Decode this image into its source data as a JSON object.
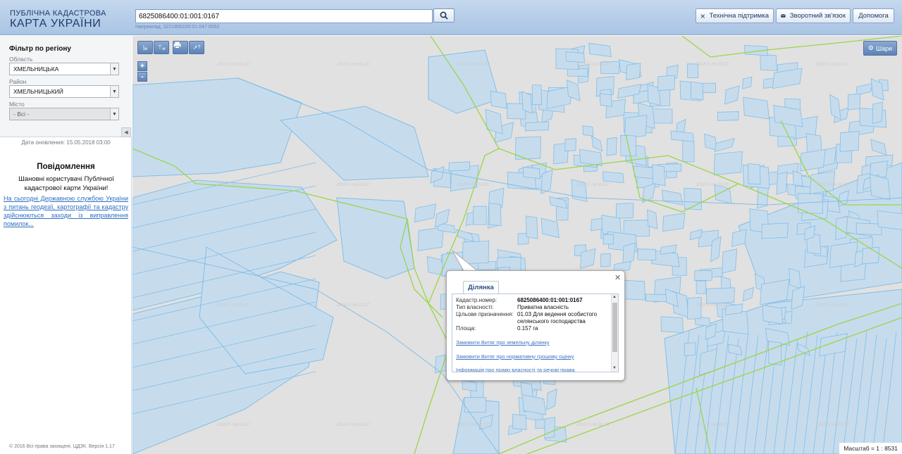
{
  "header": {
    "logo_line1": "ПУБЛІЧНА КАДАСТРОВА",
    "logo_line2": "КАРТА УКРАЇНИ",
    "search_value": "6825086400:01:001:0167",
    "search_hint": "Наприклад: 3221856100:01:047:0052",
    "buttons": {
      "support": "Технічна підтримка",
      "feedback": "Зворотний зв'язок",
      "help": "Допомога"
    }
  },
  "sidebar": {
    "filter_title": "Фільтр по регіону",
    "region_label": "Область",
    "region_value": "ХМЕЛЬНИЦЬКА",
    "district_label": "Район",
    "district_value": "ХМЕЛЬНИЦЬКИЙ",
    "city_label": "Місто",
    "city_value": "- Всі -",
    "update_date": "Дата оновлення: 15.05.2018 03:00",
    "notice_title": "Повідомлення",
    "notice_text": "Шановні користувачі Публічної кадастрової карти України!",
    "notice_link": "На сьогодні Державною службою України з питань геодезії, картографії та кадастру здійснюються заходи із виправлення помилок...",
    "copyright": "© 2016 Всі права захищені. ЦДЗК. Версія 1.17"
  },
  "map": {
    "tools": [
      "м",
      "м",
      "print",
      "?"
    ],
    "zoom_in": "+",
    "zoom_out": "-",
    "layers_label": "Шари",
    "scale_label": "Масштаб = 1 : 8531",
    "watermark": "2018 © mk.SLCC"
  },
  "popup": {
    "tab": "Ділянка",
    "rows": [
      {
        "key": "Кадастр.номер:",
        "value": "6825086400:01:001:0167"
      },
      {
        "key": "Тип власності:",
        "value": "Приватна власність"
      },
      {
        "key": "Цільове призначення:",
        "value": "01.03 Для ведення особистого селянського господарства"
      },
      {
        "key": "Площа:",
        "value": "0.157 га"
      }
    ],
    "links": [
      "Замовити Витяг про земельну ділянку",
      "Замовити Витяг про нормативну грошову оцінку",
      "Інформація про право власності та речові права"
    ]
  }
}
